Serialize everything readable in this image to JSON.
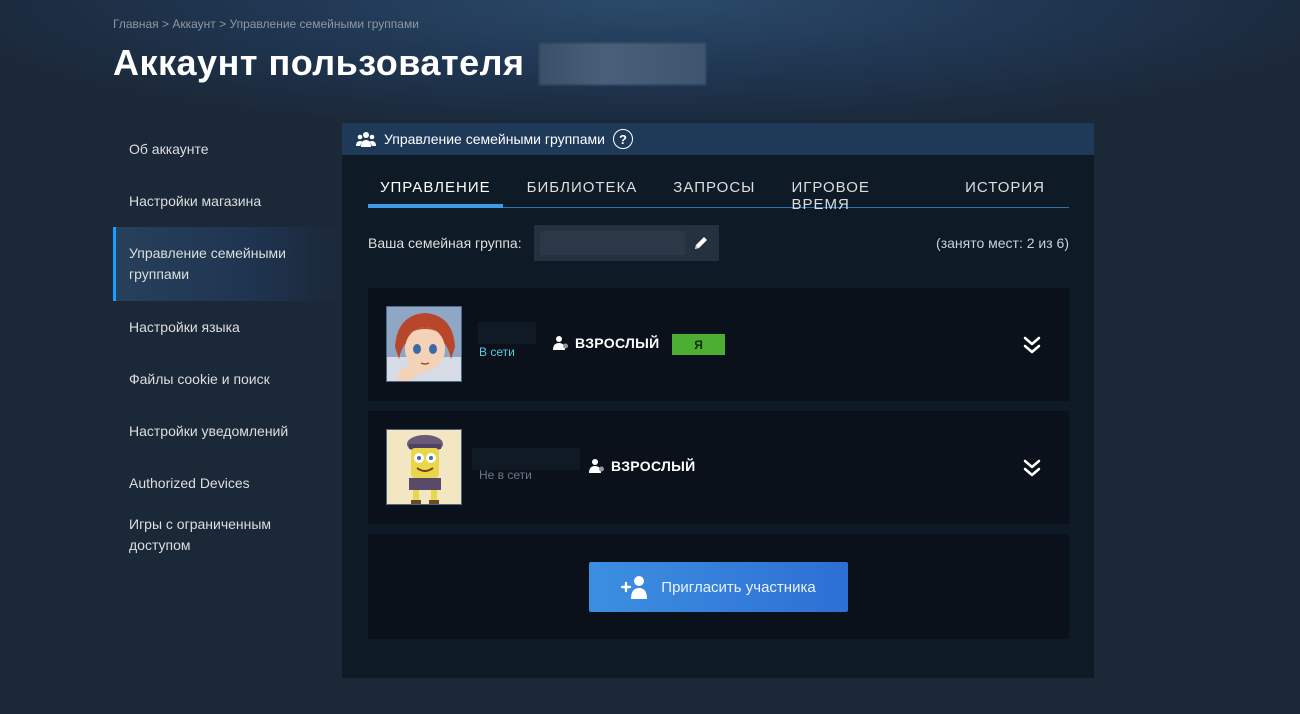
{
  "breadcrumb": {
    "home": "Главная",
    "sep1": " > ",
    "account": "Аккаунт",
    "sep2": " > ",
    "current": "Управление семейными группами"
  },
  "page": {
    "title": "Аккаунт пользователя"
  },
  "sidebar": {
    "items": [
      {
        "label": "Об аккаунте"
      },
      {
        "label": "Настройки магазина"
      },
      {
        "label": "Управление семейными группами"
      },
      {
        "label": "Настройки языка"
      },
      {
        "label": "Файлы cookie и поиск"
      },
      {
        "label": "Настройки уведомлений"
      },
      {
        "label": "Authorized Devices"
      },
      {
        "label": "Игры с ограниченным доступом"
      }
    ],
    "active_index": 2
  },
  "panel": {
    "header": "Управление семейными группами",
    "help": "?",
    "tabs": [
      {
        "label": "УПРАВЛЕНИЕ"
      },
      {
        "label": "БИБЛИОТЕКА"
      },
      {
        "label": "ЗАПРОСЫ"
      },
      {
        "label": "ИГРОВОЕ ВРЕМЯ"
      },
      {
        "label": "ИСТОРИЯ"
      }
    ],
    "active_tab": 0,
    "group_label": "Ваша семейная группа:",
    "seats": "(занято мест: 2 из 6)"
  },
  "members": [
    {
      "status": "В сети",
      "role": "ВЗРОСЛЫЙ",
      "badge": "Я"
    },
    {
      "status": "Не в сети",
      "role": "ВЗРОСЛЫЙ"
    }
  ],
  "invite": {
    "label": "Пригласить участника"
  },
  "colors": {
    "background": "#1b2838",
    "accent": "#1a9fff",
    "online": "#57cbde",
    "offline": "#6b7785",
    "me_badge": "#4cae33",
    "invite_button": "#3c8fe0"
  }
}
